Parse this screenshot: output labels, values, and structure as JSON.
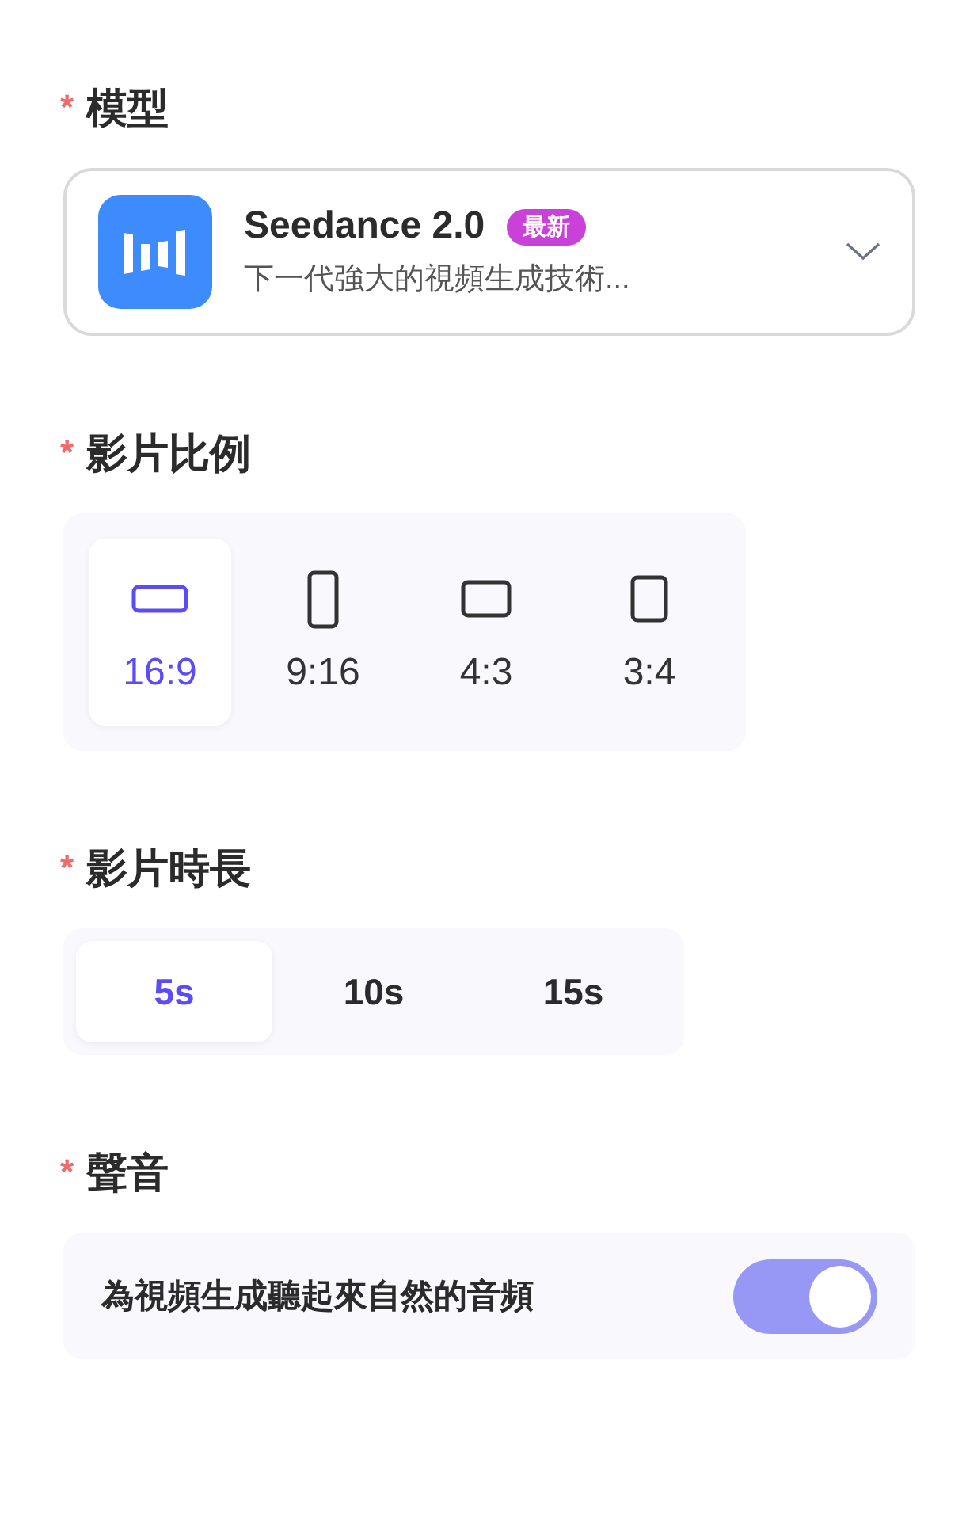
{
  "model": {
    "required_mark": "*",
    "label": "模型",
    "selector": {
      "name": "Seedance 2.0",
      "badge": "最新",
      "description": "下一代強大的視頻生成技術..."
    }
  },
  "aspect_ratio": {
    "required_mark": "*",
    "label": "影片比例",
    "options": [
      {
        "label": "16:9",
        "kind": "wide",
        "selected": true
      },
      {
        "label": "9:16",
        "kind": "tall",
        "selected": false
      },
      {
        "label": "4:3",
        "kind": "landscape",
        "selected": false
      },
      {
        "label": "3:4",
        "kind": "portrait",
        "selected": false
      }
    ]
  },
  "duration": {
    "required_mark": "*",
    "label": "影片時長",
    "options": [
      {
        "label": "5s",
        "selected": true
      },
      {
        "label": "10s",
        "selected": false
      },
      {
        "label": "15s",
        "selected": false
      }
    ]
  },
  "sound": {
    "required_mark": "*",
    "label": "聲音",
    "description": "為視頻生成聽起來自然的音頻",
    "on": true
  }
}
